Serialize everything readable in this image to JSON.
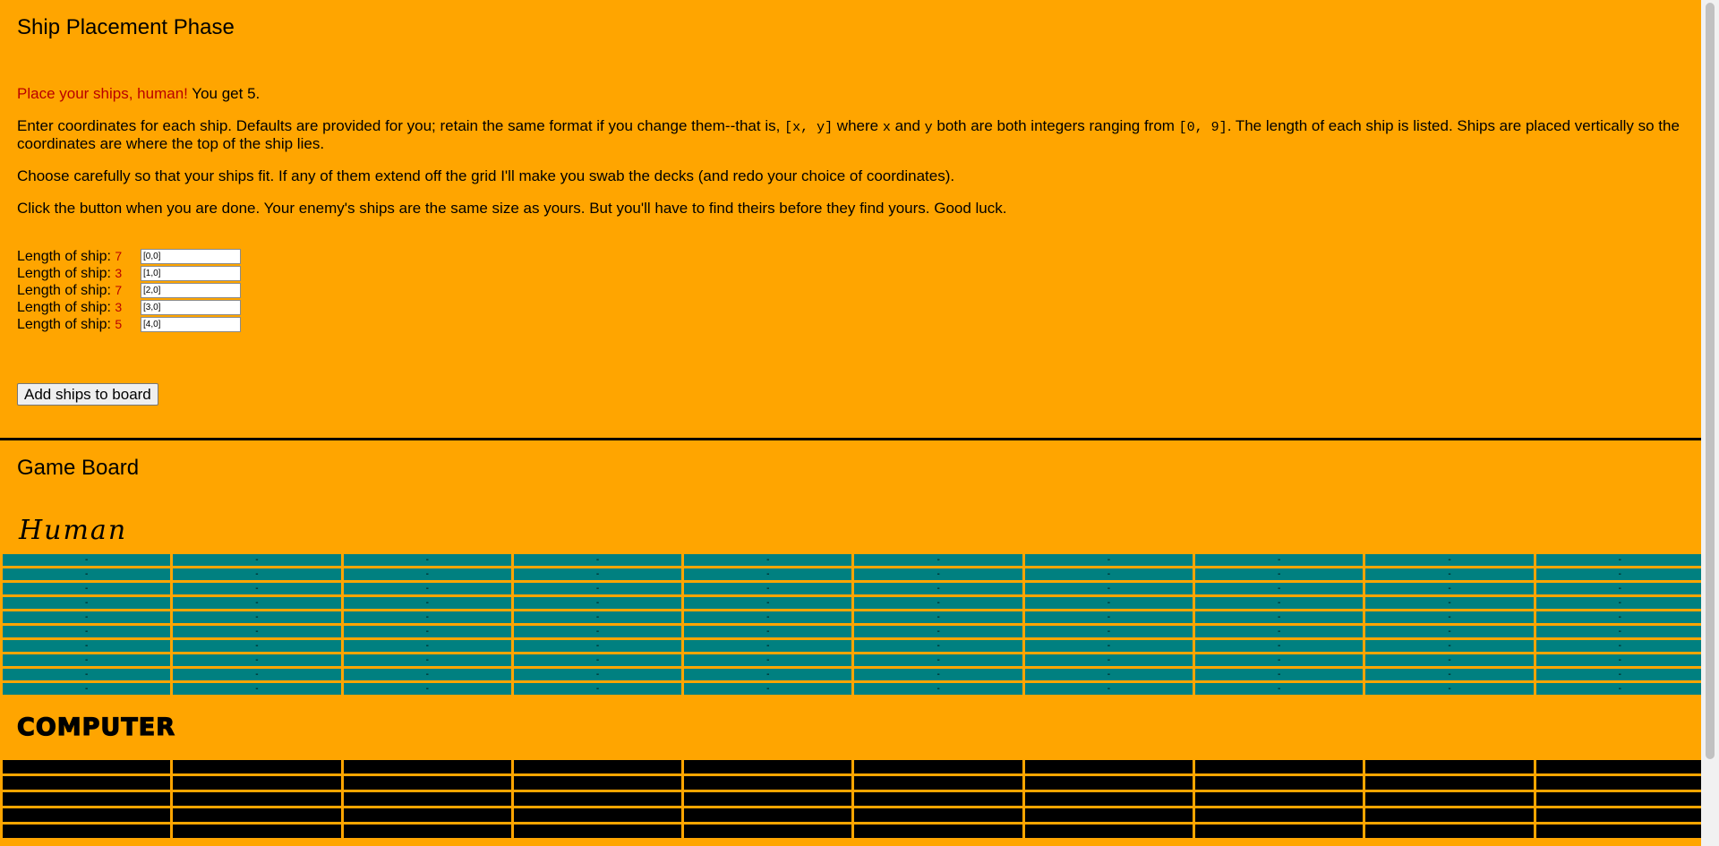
{
  "placement": {
    "title": "Ship Placement Phase",
    "intro_red": "Place your ships, human!",
    "intro_rest": " You get 5.",
    "p2_a": "Enter coordinates for each ship. Defaults are provided for you; retain the same format if you change them--that is, ",
    "p2_code1": "[x, y]",
    "p2_b": " where ",
    "p2_code2": "x",
    "p2_c": " and ",
    "p2_code3": "y",
    "p2_d": " both are both integers ranging from ",
    "p2_code4": "[0, 9]",
    "p2_e": ". The length of each ship is listed. Ships are placed vertically so the coordinates are where the top of the ship lies.",
    "p3": "Choose carefully so that your ships fit. If any of them extend off the grid I'll make you swab the decks (and redo your choice of coordinates).",
    "p4": "Click the button when you are done. Your enemy's ships are the same size as yours. But you'll have to find theirs before they find yours. Good luck.",
    "ship_label": "Length of ship: ",
    "ships": [
      {
        "length": "7",
        "value": "[0,0]"
      },
      {
        "length": "3",
        "value": "[1,0]"
      },
      {
        "length": "7",
        "value": "[2,0]"
      },
      {
        "length": "3",
        "value": "[3,0]"
      },
      {
        "length": "5",
        "value": "[4,0]"
      }
    ],
    "add_button": "Add ships to board"
  },
  "board": {
    "title": "Game Board",
    "human_label": "Human",
    "computer_label": "COMPUTER",
    "cell_symbol": "-",
    "human_rows": 10,
    "computer_rows_visible": 5,
    "cols": 10
  },
  "colors": {
    "background": "#FFA500",
    "human_cell": "#008080",
    "computer_cell": "#000000",
    "accent_red": "#B80000"
  }
}
